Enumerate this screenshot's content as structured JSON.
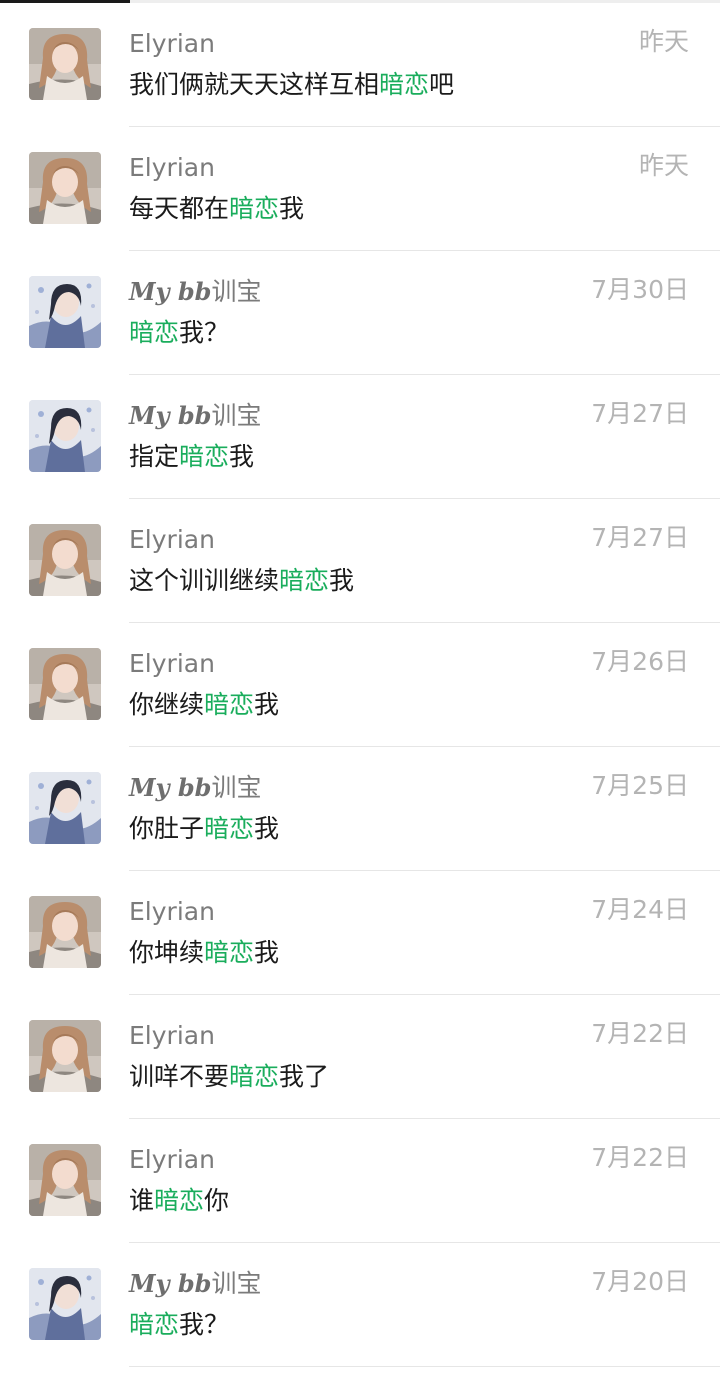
{
  "messages": [
    {
      "sender": "Elyrian",
      "avatar": "female-avatar-light",
      "date": "昨天",
      "pre": "我们俩就天天这样互相",
      "highlight": "暗恋",
      "post": "吧"
    },
    {
      "sender": "Elyrian",
      "avatar": "female-avatar-light",
      "date": "昨天",
      "pre": "每天都在",
      "highlight": "暗恋",
      "post": "我"
    },
    {
      "sender": "My bb训宝",
      "avatar": "female-avatar-blue",
      "date": "7月30日",
      "pre": "",
      "highlight": "暗恋",
      "post": "我？"
    },
    {
      "sender": "My bb训宝",
      "avatar": "female-avatar-blue",
      "date": "7月27日",
      "pre": "指定",
      "highlight": "暗恋",
      "post": "我"
    },
    {
      "sender": "Elyrian",
      "avatar": "female-avatar-light",
      "date": "7月27日",
      "pre": "这个训训继续",
      "highlight": "暗恋",
      "post": "我"
    },
    {
      "sender": "Elyrian",
      "avatar": "female-avatar-light",
      "date": "7月26日",
      "pre": "你继续",
      "highlight": "暗恋",
      "post": "我"
    },
    {
      "sender": "My bb训宝",
      "avatar": "female-avatar-blue",
      "date": "7月25日",
      "pre": "你肚子",
      "highlight": "暗恋",
      "post": "我"
    },
    {
      "sender": "Elyrian",
      "avatar": "female-avatar-light",
      "date": "7月24日",
      "pre": "你坤续",
      "highlight": "暗恋",
      "post": "我"
    },
    {
      "sender": "Elyrian",
      "avatar": "female-avatar-light",
      "date": "7月22日",
      "pre": "训咩不要",
      "highlight": "暗恋",
      "post": "我了"
    },
    {
      "sender": "Elyrian",
      "avatar": "female-avatar-light",
      "date": "7月22日",
      "pre": "谁",
      "highlight": "暗恋",
      "post": "你"
    },
    {
      "sender": "My bb训宝",
      "avatar": "female-avatar-blue",
      "date": "7月20日",
      "pre": "",
      "highlight": "暗恋",
      "post": "我？"
    }
  ],
  "colors": {
    "highlight": "#1aad5c",
    "name": "#7b7b7b",
    "date": "#b4b4b4",
    "message": "#1b1b1b",
    "divider": "#e6e6e6"
  }
}
